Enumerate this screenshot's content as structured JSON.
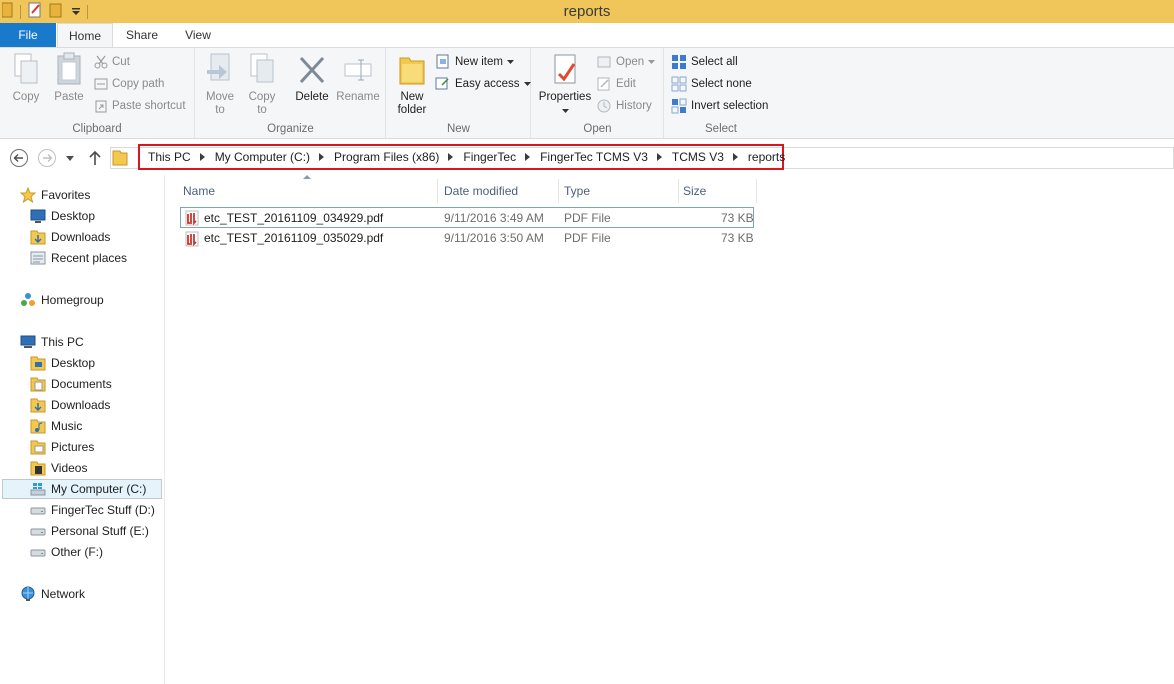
{
  "window": {
    "title": "reports"
  },
  "tabs": {
    "file": "File",
    "home": "Home",
    "share": "Share",
    "view": "View"
  },
  "ribbon": {
    "clipboard": {
      "label": "Clipboard",
      "copy": "Copy",
      "paste": "Paste",
      "cut": "Cut",
      "copy_path": "Copy path",
      "paste_shortcut": "Paste shortcut"
    },
    "organize": {
      "label": "Organize",
      "move_to_1": "Move",
      "move_to_2": "to",
      "copy_to_1": "Copy",
      "copy_to_2": "to",
      "delete": "Delete",
      "rename": "Rename"
    },
    "new": {
      "label": "New",
      "new_folder_1": "New",
      "new_folder_2": "folder",
      "new_item": "New item",
      "easy_access": "Easy access"
    },
    "open": {
      "label": "Open",
      "properties": "Properties",
      "open": "Open",
      "edit": "Edit",
      "history": "History"
    },
    "select": {
      "label": "Select",
      "select_all": "Select all",
      "select_none": "Select none",
      "invert": "Invert selection"
    }
  },
  "breadcrumb": [
    "This PC",
    "My Computer (C:)",
    "Program Files (x86)",
    "FingerTec",
    "FingerTec TCMS V3",
    "TCMS V3",
    "reports"
  ],
  "nav": {
    "favorites": "Favorites",
    "fav_desktop": "Desktop",
    "fav_downloads": "Downloads",
    "fav_recent": "Recent places",
    "homegroup": "Homegroup",
    "this_pc": "This PC",
    "pc_desktop": "Desktop",
    "pc_documents": "Documents",
    "pc_downloads": "Downloads",
    "pc_music": "Music",
    "pc_pictures": "Pictures",
    "pc_videos": "Videos",
    "drive_c": "My Computer (C:)",
    "drive_d": "FingerTec Stuff (D:)",
    "drive_e": "Personal Stuff (E:)",
    "drive_f": "Other (F:)",
    "network": "Network"
  },
  "columns": {
    "name": "Name",
    "date": "Date modified",
    "type": "Type",
    "size": "Size"
  },
  "files": [
    {
      "name": "etc_TEST_20161109_034929.pdf",
      "date": "9/11/2016 3:49 AM",
      "type": "PDF File",
      "size": "73 KB"
    },
    {
      "name": "etc_TEST_20161109_035029.pdf",
      "date": "9/11/2016 3:50 AM",
      "type": "PDF File",
      "size": "73 KB"
    }
  ],
  "colors": {
    "titlebar": "#f0c65a",
    "file_tab": "#1979ca",
    "highlight": "#d9151d",
    "selection": "#e5f3fb"
  }
}
